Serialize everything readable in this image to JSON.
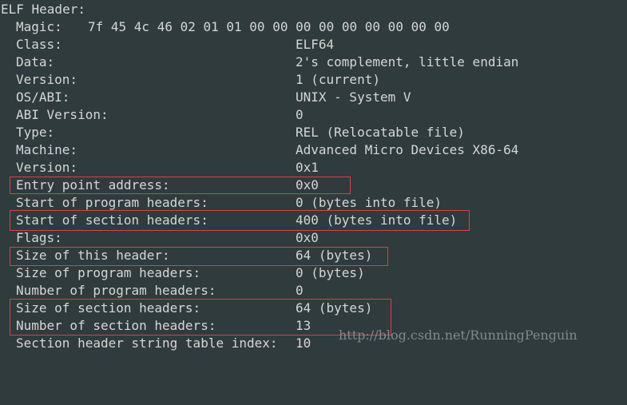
{
  "terminal": {
    "title": "ELF Header:",
    "magic": {
      "label": "Magic:",
      "value": "7f 45 4c 46 02 01 01 00 00 00 00 00 00 00 00 00"
    },
    "fields": [
      {
        "label": "Class:",
        "value": "ELF64"
      },
      {
        "label": "Data:",
        "value": "2's complement, little endian"
      },
      {
        "label": "Version:",
        "value": "1 (current)"
      },
      {
        "label": "OS/ABI:",
        "value": "UNIX - System V"
      },
      {
        "label": "ABI Version:",
        "value": "0"
      },
      {
        "label": "Type:",
        "value": "REL (Relocatable file)"
      },
      {
        "label": "Machine:",
        "value": "Advanced Micro Devices X86-64"
      },
      {
        "label": "Version:",
        "value": "0x1"
      },
      {
        "label": "Entry point address:",
        "value": "0x0"
      },
      {
        "label": "Start of program headers:",
        "value": "0 (bytes into file)"
      },
      {
        "label": "Start of section headers:",
        "value": "400 (bytes into file)"
      },
      {
        "label": "Flags:",
        "value": "0x0"
      },
      {
        "label": "Size of this header:",
        "value": "64 (bytes)"
      },
      {
        "label": "Size of program headers:",
        "value": "0 (bytes)"
      },
      {
        "label": "Number of program headers:",
        "value": "0"
      },
      {
        "label": "Size of section headers:",
        "value": "64 (bytes)"
      },
      {
        "label": "Number of section headers:",
        "value": "13"
      },
      {
        "label": "Section header string table index:",
        "value": "10"
      }
    ]
  },
  "watermark": "http://blog.csdn.net/RunningPenguin",
  "colors": {
    "background": "#2f3b3d",
    "text": "#d6d6d6",
    "highlight": "#d9414a",
    "watermark": "#8a9294"
  }
}
